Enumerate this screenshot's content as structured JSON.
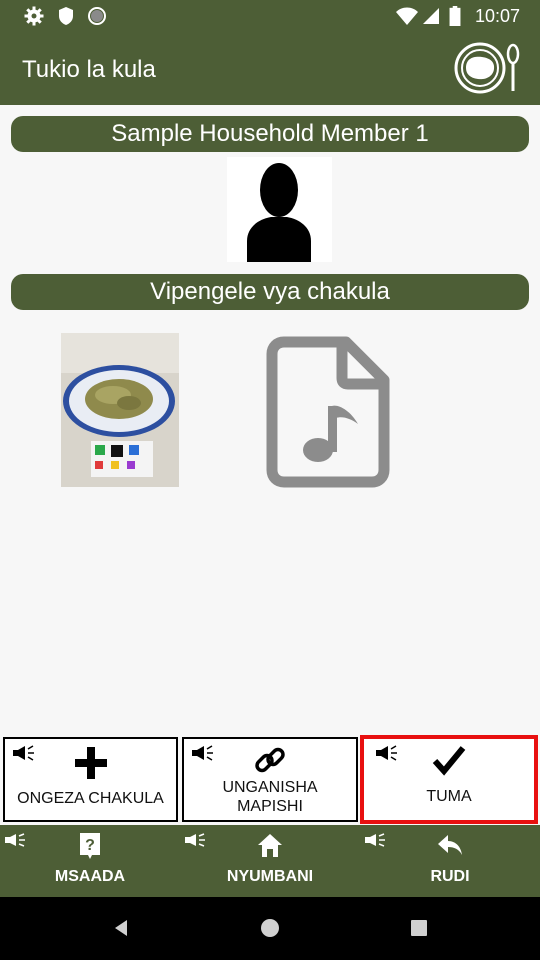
{
  "status_bar": {
    "time": "10:07",
    "icons": [
      "gear-icon",
      "shield-icon",
      "circle-icon",
      "wifi-icon",
      "signal-icon",
      "battery-icon"
    ]
  },
  "app_bar": {
    "title": "Tukio la kula",
    "logo_icon": "plate-spoon-icon"
  },
  "member": {
    "name": "Sample Household Member 1",
    "avatar_icon": "person-silhouette-icon"
  },
  "food": {
    "header": "Vipengele vya chakula",
    "items": [
      {
        "type": "photo",
        "icon": "food-photo"
      },
      {
        "type": "audio",
        "icon": "audio-file-icon"
      }
    ]
  },
  "actions": {
    "add_food": "ONGEZA CHAKULA",
    "link_recipe_line1": "UNGANISHA",
    "link_recipe_line2": "MAPISHI",
    "send": "TUMA"
  },
  "bottom_nav": {
    "help": "MSAADA",
    "home": "NYUMBANI",
    "back": "RUDI"
  },
  "colors": {
    "brand": "#4d5e36",
    "highlight": "#e81010"
  }
}
